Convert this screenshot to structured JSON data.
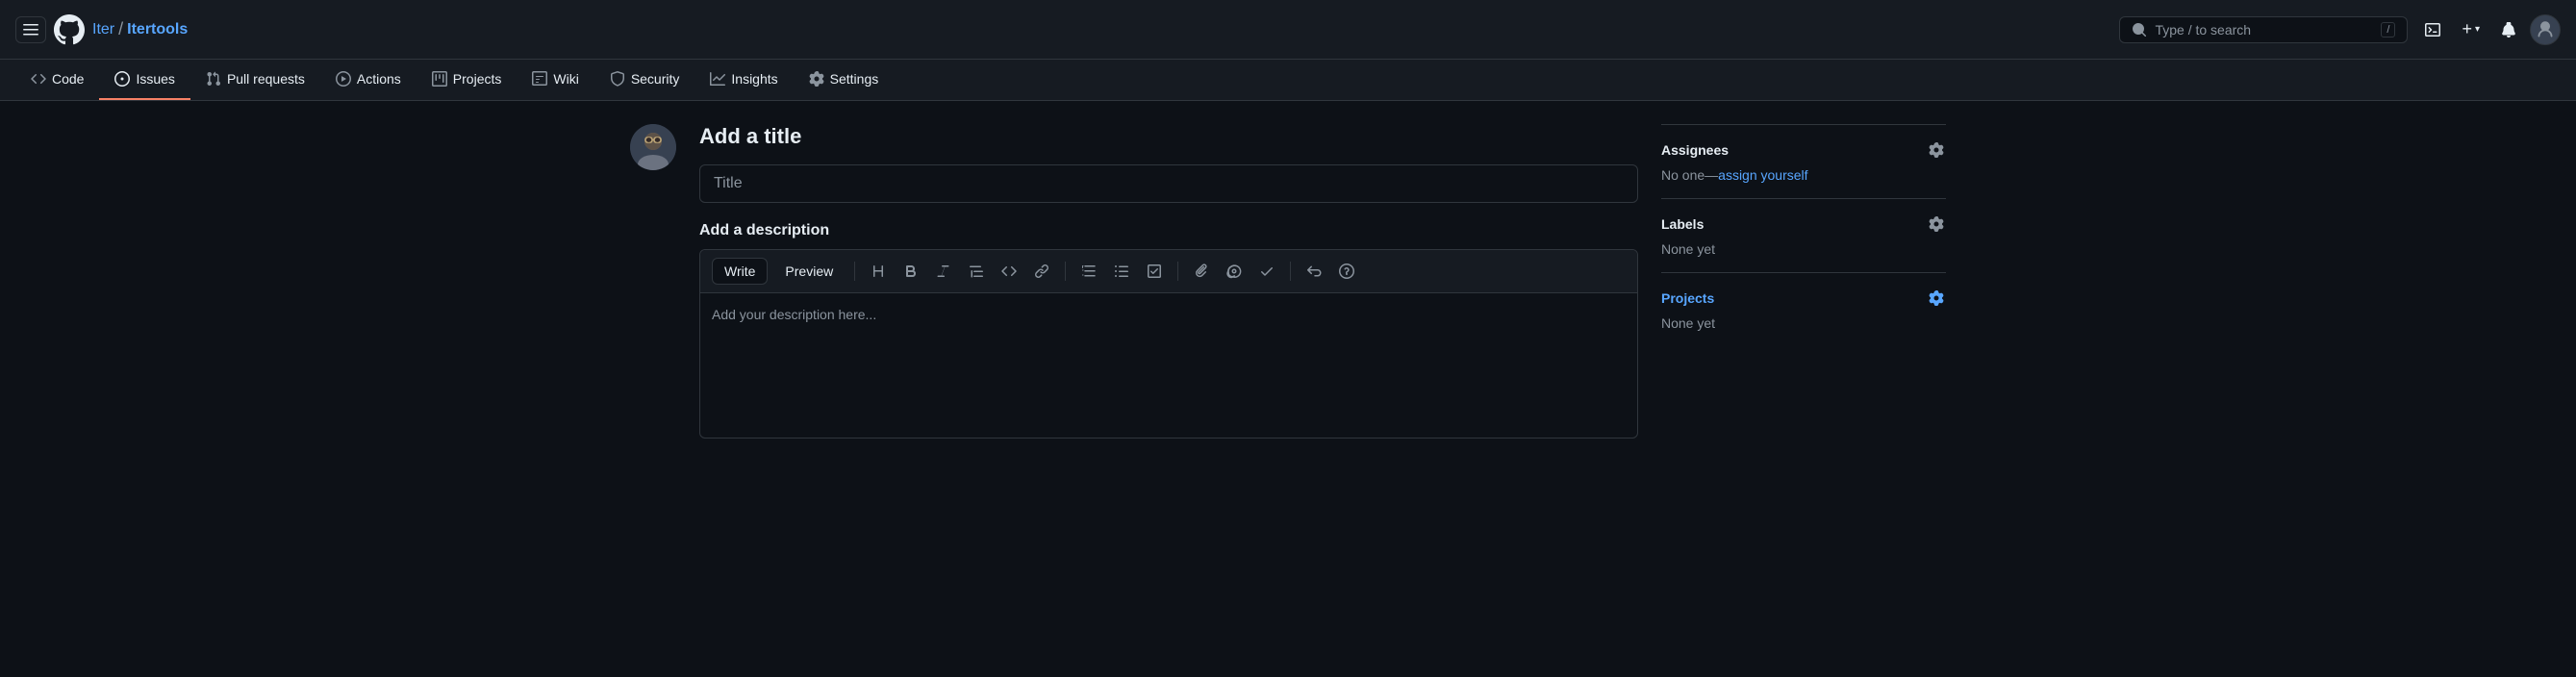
{
  "topNav": {
    "hamburger_label": "☰",
    "owner": "Iter",
    "separator": "/",
    "repo": "Itertools",
    "search_placeholder": "Type / to search",
    "search_slash": "/",
    "plus_icon": "+",
    "chevron_icon": "▾"
  },
  "repoNav": {
    "items": [
      {
        "id": "code",
        "label": "Code",
        "icon": "code"
      },
      {
        "id": "issues",
        "label": "Issues",
        "icon": "issues",
        "active": true
      },
      {
        "id": "pull-requests",
        "label": "Pull requests",
        "icon": "pr"
      },
      {
        "id": "actions",
        "label": "Actions",
        "icon": "actions"
      },
      {
        "id": "projects",
        "label": "Projects",
        "icon": "projects"
      },
      {
        "id": "wiki",
        "label": "Wiki",
        "icon": "wiki"
      },
      {
        "id": "security",
        "label": "Security",
        "icon": "security"
      },
      {
        "id": "insights",
        "label": "Insights",
        "icon": "insights"
      },
      {
        "id": "settings",
        "label": "Settings",
        "icon": "settings"
      }
    ]
  },
  "form": {
    "title_heading": "Add a title",
    "title_placeholder": "Title",
    "description_heading": "Add a description",
    "write_tab": "Write",
    "preview_tab": "Preview",
    "description_placeholder": "Add your description here...",
    "toolbar": {
      "heading": "H",
      "bold": "B",
      "italic": "I",
      "quote": "❝",
      "code": "<>",
      "link": "🔗",
      "ordered_list": "ol",
      "unordered_list": "ul",
      "task_list": "☑",
      "attach": "📎",
      "mention": "@",
      "reference": "⧉",
      "undo": "↩",
      "slash": "⊘"
    }
  },
  "sidebar": {
    "assignees_title": "Assignees",
    "assignees_value": "No one—",
    "assign_yourself_label": "assign yourself",
    "labels_title": "Labels",
    "labels_value": "None yet",
    "projects_title": "Projects",
    "projects_value": "None yet"
  }
}
